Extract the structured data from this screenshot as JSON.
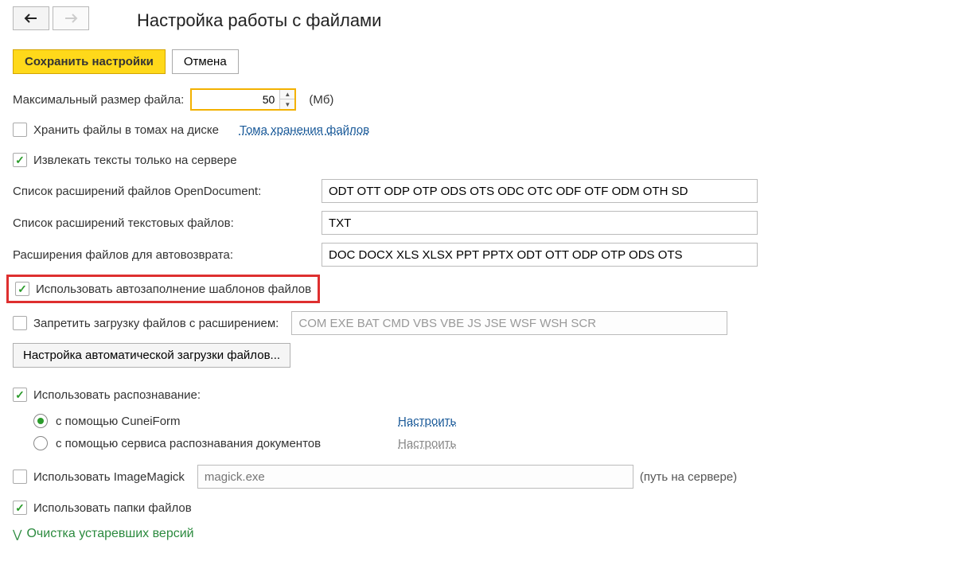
{
  "header": {
    "title": "Настройка работы с файлами"
  },
  "buttons": {
    "save": "Сохранить настройки",
    "cancel": "Отмена",
    "auto_upload_settings": "Настройка автоматической загрузки файлов..."
  },
  "labels": {
    "max_file_size": "Максимальный размер файла:",
    "unit_mb": "(Мб)",
    "store_in_volumes": "Хранить файлы в томах на диске",
    "volumes_link": "Тома хранения файлов",
    "extract_on_server": "Извлекать тексты только на сервере",
    "open_doc_ext": "Список расширений файлов OpenDocument:",
    "text_ext": "Список расширений текстовых файлов:",
    "auto_return_ext": "Расширения файлов для автовозврата:",
    "use_autofill_templates": "Использовать автозаполнение шаблонов файлов",
    "forbid_upload_ext": "Запретить загрузку файлов с расширением:",
    "use_ocr": "Использовать распознавание:",
    "ocr_cuneiform": "с помощью CuneiForm",
    "ocr_service": "с помощью сервиса распознавания документов",
    "configure": "Настроить",
    "use_imagemagick": "Использовать ImageMagick",
    "imagemagick_placeholder": "magick.exe",
    "path_on_server": "(путь на сервере)",
    "use_file_folders": "Использовать папки файлов",
    "cleanup_versions": "Очистка устаревших версий"
  },
  "values": {
    "max_file_size": "50",
    "open_doc_ext": "ODT OTT ODP OTP ODS OTS ODC OTC ODF OTF ODM OTH SD",
    "text_ext": "TXT",
    "auto_return_ext": "DOC DOCX XLS XLSX PPT PPTX ODT OTT ODP OTP ODS OTS",
    "forbid_ext": "COM EXE BAT CMD VBS VBE JS JSE WSF WSH SCR"
  }
}
